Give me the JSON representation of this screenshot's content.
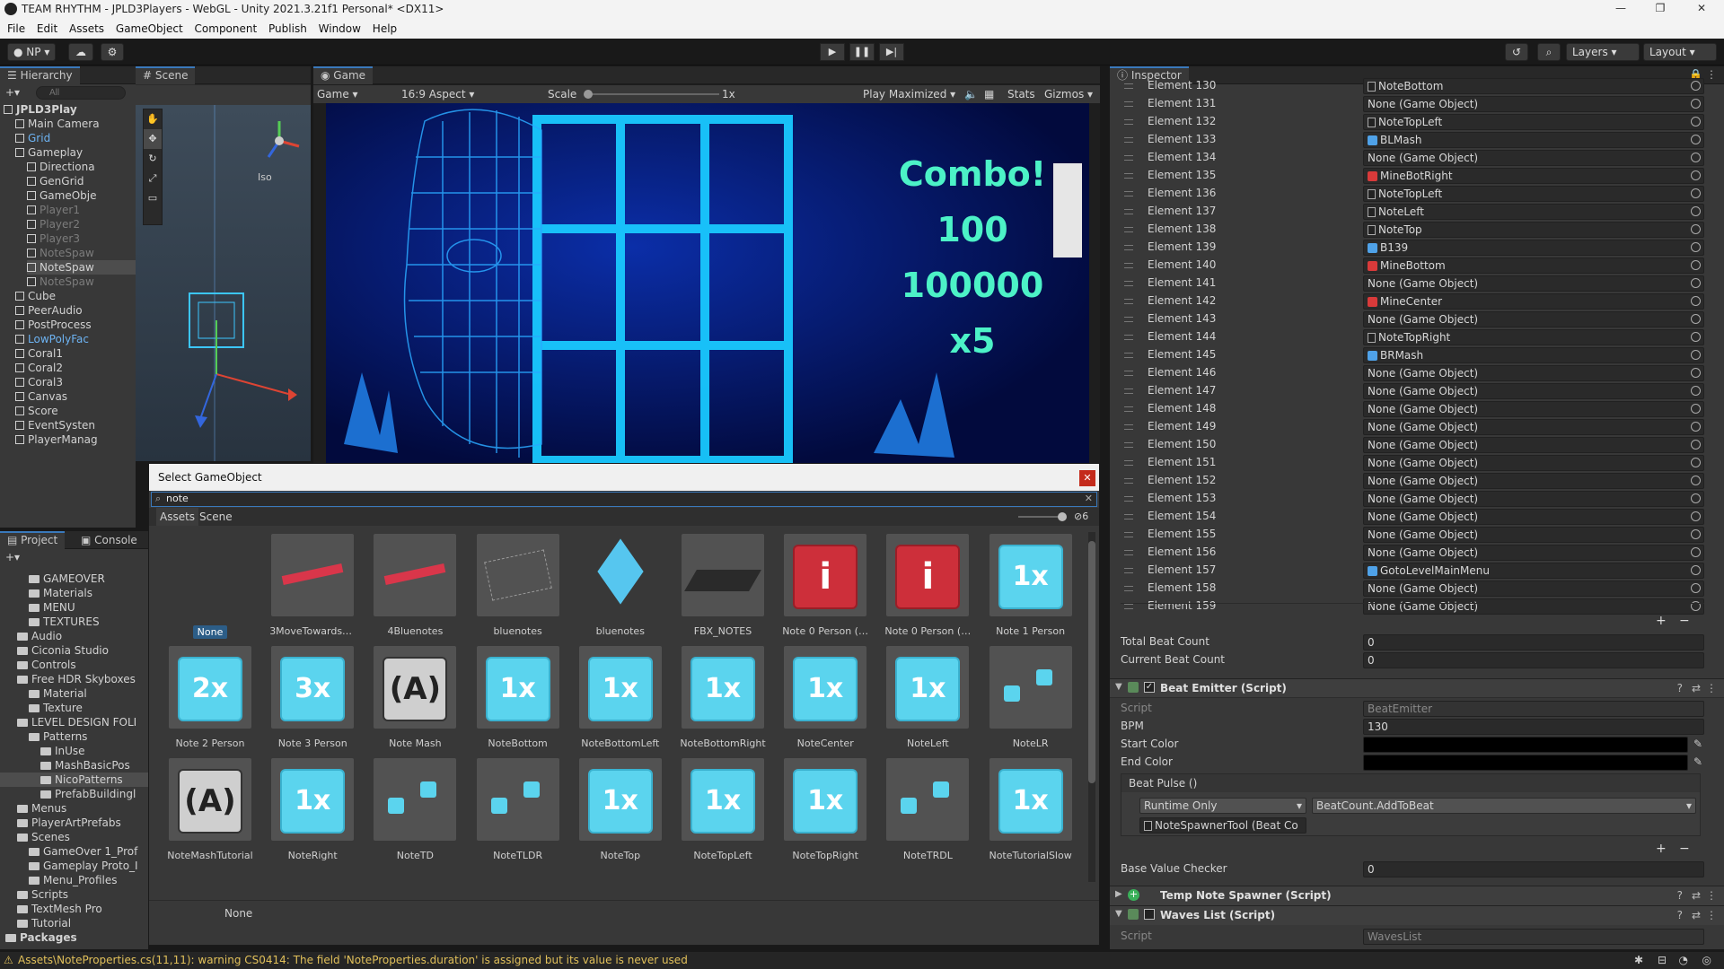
{
  "window": {
    "title": "TEAM RHYTHM - JPLD3Players - WebGL - Unity 2021.3.21f1 Personal* <DX11>"
  },
  "menu": [
    "File",
    "Edit",
    "Assets",
    "GameObject",
    "Component",
    "Publish",
    "Window",
    "Help"
  ],
  "toolbar": {
    "account": "NP",
    "layers": "Layers",
    "layout": "Layout"
  },
  "hierarchy": {
    "tab": "Hierarchy",
    "search_placeholder": "All",
    "items": [
      {
        "label": "JPLD3Play",
        "depth": 0
      },
      {
        "label": "Main Camera",
        "depth": 1
      },
      {
        "label": "Grid",
        "depth": 1,
        "color": "#6db3f2"
      },
      {
        "label": "Gameplay",
        "depth": 1
      },
      {
        "label": "Directiona",
        "depth": 2
      },
      {
        "label": "GenGrid",
        "depth": 2
      },
      {
        "label": "GameObje",
        "depth": 2
      },
      {
        "label": "Player1",
        "depth": 2,
        "dim": true
      },
      {
        "label": "Player2",
        "depth": 2,
        "dim": true
      },
      {
        "label": "Player3",
        "depth": 2,
        "dim": true
      },
      {
        "label": "NoteSpaw",
        "depth": 2,
        "dim": true
      },
      {
        "label": "NoteSpaw",
        "depth": 2
      },
      {
        "label": "NoteSpaw",
        "depth": 2,
        "dim": true
      },
      {
        "label": "Cube",
        "depth": 1
      },
      {
        "label": "PeerAudio",
        "depth": 1
      },
      {
        "label": "PostProcess",
        "depth": 1
      },
      {
        "label": "LowPolyFac",
        "depth": 1,
        "color": "#6db3f2"
      },
      {
        "label": "Coral1",
        "depth": 1
      },
      {
        "label": "Coral2",
        "depth": 1
      },
      {
        "label": "Coral3",
        "depth": 1
      },
      {
        "label": "Canvas",
        "depth": 1
      },
      {
        "label": "Score",
        "depth": 1
      },
      {
        "label": "EventSysten",
        "depth": 1
      },
      {
        "label": "PlayerManag",
        "depth": 1
      }
    ]
  },
  "scene": {
    "tab": "Scene",
    "iso_label": "Iso"
  },
  "game": {
    "tab": "Game",
    "display": "Game",
    "aspect": "16:9 Aspect",
    "scale_label": "Scale",
    "scale_value": "1x",
    "play_mode": "Play Maximized",
    "stats": "Stats",
    "gizmos": "Gizmos",
    "overlay": {
      "combo": "Combo!",
      "count": "100",
      "score": "100000",
      "mult": "x5"
    }
  },
  "project": {
    "tabs": [
      "Project",
      "Console"
    ],
    "items": [
      {
        "label": "GAMEOVER",
        "depth": 2
      },
      {
        "label": "Materials",
        "depth": 2
      },
      {
        "label": "MENU",
        "depth": 2
      },
      {
        "label": "TEXTURES",
        "depth": 2
      },
      {
        "label": "Audio",
        "depth": 1
      },
      {
        "label": "Ciconia Studio",
        "depth": 1
      },
      {
        "label": "Controls",
        "depth": 1
      },
      {
        "label": "Free HDR Skyboxes",
        "depth": 1
      },
      {
        "label": "Material",
        "depth": 2
      },
      {
        "label": "Texture",
        "depth": 2
      },
      {
        "label": "LEVEL DESIGN FOLI",
        "depth": 1
      },
      {
        "label": "Patterns",
        "depth": 2
      },
      {
        "label": "InUse",
        "depth": 3
      },
      {
        "label": "MashBasicPos",
        "depth": 3
      },
      {
        "label": "NicoPatterns",
        "depth": 3
      },
      {
        "label": "PrefabBuildingl",
        "depth": 3
      },
      {
        "label": "Menus",
        "depth": 1
      },
      {
        "label": "PlayerArtPrefabs",
        "depth": 1
      },
      {
        "label": "Scenes",
        "depth": 1
      },
      {
        "label": "GameOver 1_Prof",
        "depth": 2
      },
      {
        "label": "Gameplay Proto_I",
        "depth": 2
      },
      {
        "label": "Menu_Profiles",
        "depth": 2
      },
      {
        "label": "Scripts",
        "depth": 1
      },
      {
        "label": "TextMesh Pro",
        "depth": 1
      },
      {
        "label": "Tutorial",
        "depth": 1
      },
      {
        "label": "Packages",
        "depth": 0
      }
    ]
  },
  "dialog": {
    "title": "Select GameObject",
    "search_value": "note",
    "tabs": [
      "Assets",
      "Scene"
    ],
    "hidden_count": "6",
    "footer": "None",
    "assets": [
      {
        "label": "None",
        "kind": "none"
      },
      {
        "label": "3MoveTowardsBl...",
        "kind": "strip"
      },
      {
        "label": "4Bluenotes",
        "kind": "strip"
      },
      {
        "label": "bluenotes",
        "kind": "sketch"
      },
      {
        "label": "bluenotes",
        "kind": "smallcube"
      },
      {
        "label": "FBX_NOTES",
        "kind": "plane"
      },
      {
        "label": "Note 0 Person (M...",
        "kind": "red"
      },
      {
        "label": "Note 0 Person (M...",
        "kind": "red"
      },
      {
        "label": "Note 1 Person",
        "kind": "blue",
        "glyph": "1x"
      },
      {
        "label": "Note 2 Person",
        "kind": "blue",
        "glyph": "2x"
      },
      {
        "label": "Note 3 Person",
        "kind": "blue",
        "glyph": "3x"
      },
      {
        "label": "Note Mash",
        "kind": "gray",
        "glyph": "A"
      },
      {
        "label": "NoteBottom",
        "kind": "blue",
        "glyph": "1x"
      },
      {
        "label": "NoteBottomLeft",
        "kind": "blue",
        "glyph": "1x"
      },
      {
        "label": "NoteBottomRight",
        "kind": "blue",
        "glyph": "1x"
      },
      {
        "label": "NoteCenter",
        "kind": "blue",
        "glyph": "1x"
      },
      {
        "label": "NoteLeft",
        "kind": "blue",
        "glyph": "1x"
      },
      {
        "label": "NoteLR",
        "kind": "pair"
      },
      {
        "label": "NoteMashTutorial",
        "kind": "gray",
        "glyph": "A"
      },
      {
        "label": "NoteRight",
        "kind": "blue",
        "glyph": "1x"
      },
      {
        "label": "NoteTD",
        "kind": "pair"
      },
      {
        "label": "NoteTLDR",
        "kind": "pair"
      },
      {
        "label": "NoteTop",
        "kind": "blue",
        "glyph": "1x"
      },
      {
        "label": "NoteTopLeft",
        "kind": "blue",
        "glyph": "1x"
      },
      {
        "label": "NoteTopRight",
        "kind": "blue",
        "glyph": "1x"
      },
      {
        "label": "NoteTRDL",
        "kind": "pair"
      },
      {
        "label": "NoteTutorialSlow",
        "kind": "blue",
        "glyph": "1x"
      }
    ]
  },
  "inspector": {
    "tab": "Inspector",
    "elements": [
      {
        "label": "Element 130",
        "value": "NoteBottom",
        "icon": "note"
      },
      {
        "label": "Element 131",
        "value": "None (Game Object)",
        "icon": ""
      },
      {
        "label": "Element 132",
        "value": "NoteTopLeft",
        "icon": "note"
      },
      {
        "label": "Element 133",
        "value": "BLMash",
        "icon": "blue"
      },
      {
        "label": "Element 134",
        "value": "None (Game Object)",
        "icon": ""
      },
      {
        "label": "Element 135",
        "value": "MineBotRight",
        "icon": "red"
      },
      {
        "label": "Element 136",
        "value": "NoteTopLeft",
        "icon": "note"
      },
      {
        "label": "Element 137",
        "value": "NoteLeft",
        "icon": "note"
      },
      {
        "label": "Element 138",
        "value": "NoteTop",
        "icon": "note"
      },
      {
        "label": "Element 139",
        "value": "B139",
        "icon": "blue"
      },
      {
        "label": "Element 140",
        "value": "MineBottom",
        "icon": "red"
      },
      {
        "label": "Element 141",
        "value": "None (Game Object)",
        "icon": ""
      },
      {
        "label": "Element 142",
        "value": "MineCenter",
        "icon": "red"
      },
      {
        "label": "Element 143",
        "value": "None (Game Object)",
        "icon": ""
      },
      {
        "label": "Element 144",
        "value": "NoteTopRight",
        "icon": "note"
      },
      {
        "label": "Element 145",
        "value": "BRMash",
        "icon": "blue"
      },
      {
        "label": "Element 146",
        "value": "None (Game Object)",
        "icon": ""
      },
      {
        "label": "Element 147",
        "value": "None (Game Object)",
        "icon": ""
      },
      {
        "label": "Element 148",
        "value": "None (Game Object)",
        "icon": ""
      },
      {
        "label": "Element 149",
        "value": "None (Game Object)",
        "icon": ""
      },
      {
        "label": "Element 150",
        "value": "None (Game Object)",
        "icon": ""
      },
      {
        "label": "Element 151",
        "value": "None (Game Object)",
        "icon": ""
      },
      {
        "label": "Element 152",
        "value": "None (Game Object)",
        "icon": ""
      },
      {
        "label": "Element 153",
        "value": "None (Game Object)",
        "icon": ""
      },
      {
        "label": "Element 154",
        "value": "None (Game Object)",
        "icon": ""
      },
      {
        "label": "Element 155",
        "value": "None (Game Object)",
        "icon": ""
      },
      {
        "label": "Element 156",
        "value": "None (Game Object)",
        "icon": ""
      },
      {
        "label": "Element 157",
        "value": "GotoLevelMainMenu",
        "icon": "blue"
      },
      {
        "label": "Element 158",
        "value": "None (Game Object)",
        "icon": ""
      },
      {
        "label": "Element 159",
        "value": "None (Game Object)",
        "icon": ""
      }
    ],
    "total_beat_count": {
      "label": "Total Beat Count",
      "value": "0"
    },
    "current_beat_count": {
      "label": "Current Beat Count",
      "value": "0"
    },
    "beat_emitter": {
      "header": "Beat Emitter (Script)",
      "script_label": "Script",
      "script_value": "BeatEmitter",
      "bpm_label": "BPM",
      "bpm_value": "130",
      "start_color_label": "Start Color",
      "end_color_label": "End Color",
      "event_label": "Beat Pulse ()",
      "runtime": "Runtime Only",
      "function": "BeatCount.AddToBeat",
      "target": "NoteSpawnerTool (Beat Co",
      "base_value_label": "Base Value Checker",
      "base_value": "0"
    },
    "temp_note_spawner": "Temp Note Spawner (Script)",
    "waves_list": {
      "header": "Waves List (Script)",
      "script_label": "Script",
      "script_value": "WavesList"
    }
  },
  "status": {
    "message": "Assets\\NoteProperties.cs(11,11): warning CS0414: The field 'NoteProperties.duration' is assigned but its value is never used"
  },
  "colors": {
    "accent": "#3a79bb",
    "neon": "#19c9ff",
    "combo": "#4cf2c7"
  }
}
